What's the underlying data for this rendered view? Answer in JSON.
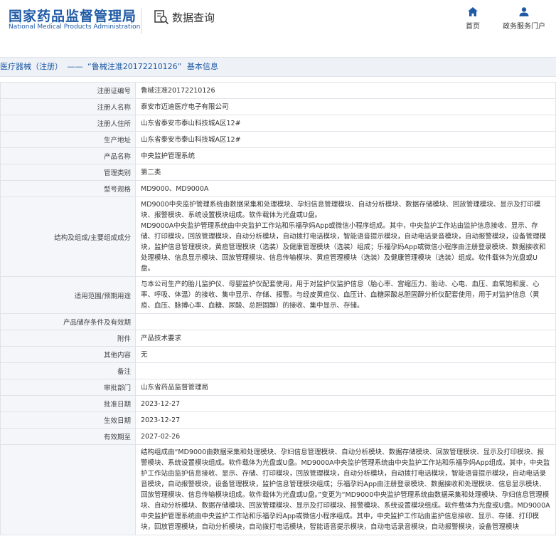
{
  "header": {
    "logo_cn": "国家药品监督管理局",
    "logo_en": "National Medical Products Administration",
    "query_label": "数据查询",
    "nav_home": "首页",
    "nav_gov": "政务服务门户",
    "brand_color": "#1f5aa6"
  },
  "breadcrumb": {
    "category": "医疗器械（注册）",
    "separator": "——",
    "record": "“鲁械注准20172210126”",
    "suffix": "基本信息"
  },
  "rows": [
    {
      "label": "注册证编号",
      "value": "鲁械注准20172210126"
    },
    {
      "label": "注册人名称",
      "value": "泰安市迈迪医疗电子有限公司"
    },
    {
      "label": "注册人住所",
      "value": "山东省泰安市泰山科技城A区12#"
    },
    {
      "label": "生产地址",
      "value": "山东省泰安市泰山科技城A区12#"
    },
    {
      "label": "产品名称",
      "value": "中央监护管理系统"
    },
    {
      "label": "管理类别",
      "value": "第二类"
    },
    {
      "label": "型号规格",
      "value": "MD9000、MD9000A"
    },
    {
      "label": "结构及组成/主要组成成分",
      "value": "MD9000中央监护管理系统由数据采集和处理模块、孕妇信息管理模块、自动分析模块、数据存储模块、回放管理模块、显示及打印模块、报警模块、系统设置模块组成。软件载体为光盘或U盘。\nMD9000A中央监护管理系统由中央监护工作站和乐福孕妈App或微信小程序组成。其中，中央监护工作站由监护信息接收、显示、存储、打印模块，回放管理模块，自动分析模块，自动拨打电话模块，智能语音提示模块，自动电话录音模块，自动报警模块，设备管理模块，监护信息管理模块，黄疸管理模块（选装）及健康管理模块（选装）组成；乐福孕妈App或微信小程序由注册登录模块、数据接收和处理模块、信息显示模块、回放管理模块、信息传输模块、黄疸管理模块（选装）及健康管理模块（选装）组成。软件载体为光盘或U盘。"
    },
    {
      "label": "适用范围/预期用途",
      "value": "与本公司生产的胎儿监护仪、母婴监护仪配套使用，用于对监护仪监护信息（胎心率、宫缩压力、胎动、心电、血压、血氧饱和度、心率、呼吸、体温）的接收、集中显示、存储、报警。与经皮黄疸仪、血压计、血糖尿酸总胆固醇分析仪配套使用，用于对监护信息（黄疸、血压、脉搏心率、血糖、尿酸、总胆固醇）的接收、集中显示、存储。"
    },
    {
      "label": "产品储存条件及有效期",
      "value": ""
    },
    {
      "label": "附件",
      "value": "产品技术要求"
    },
    {
      "label": "其他内容",
      "value": "无"
    },
    {
      "label": "备注",
      "value": ""
    },
    {
      "label": "审批部门",
      "value": "山东省药品监督管理局"
    },
    {
      "label": "批准日期",
      "value": "2023-12-27"
    },
    {
      "label": "生效日期",
      "value": "2023-12-27"
    },
    {
      "label": "有效期至",
      "value": "2027-02-26"
    },
    {
      "label": "",
      "value": "结构组成由“MD9000由数据采集和处理模块、孕妇信息管理模块、自动分析模块、数据存储模块、回放管理模块、显示及打印模块、报警模块、系统设置模块组成。软件载体为光盘或U盘。MD9000A中央监护管理系统由中央监护工作站和乐福孕妈App组成。其中，中央监护工作站由监护信息接收、显示、存储、打印模块，回放管理模块，自动分析模块，自动拨打电话模块，智能语音提示模块，自动电话录音模块，自动报警模块，设备管理模块，监护信息管理模块组成；乐福孕妈App由注册登录模块、数据接收和处理模块、信息显示模块、回放管理模块、信息传输模块组成。软件载体为光盘或U盘。”变更为“MD9000中央监护管理系统由数据采集和处理模块、孕妇信息管理模块、自动分析模块、数据存储模块、回放管理模块、显示及打印模块、报警模块、系统设置模块组成。软件载体为光盘或U盘。MD9000A中央监护管理系统由中央监护工作站和乐福孕妈App或微信小程序组成。其中，中央监护工作站由监护信息接收、显示、存储、打印模块，回放管理模块，自动分析模块，自动拨打电话模块，智能语音提示模块，自动电话录音模块，自动报警模块，设备管理模块"
    }
  ]
}
